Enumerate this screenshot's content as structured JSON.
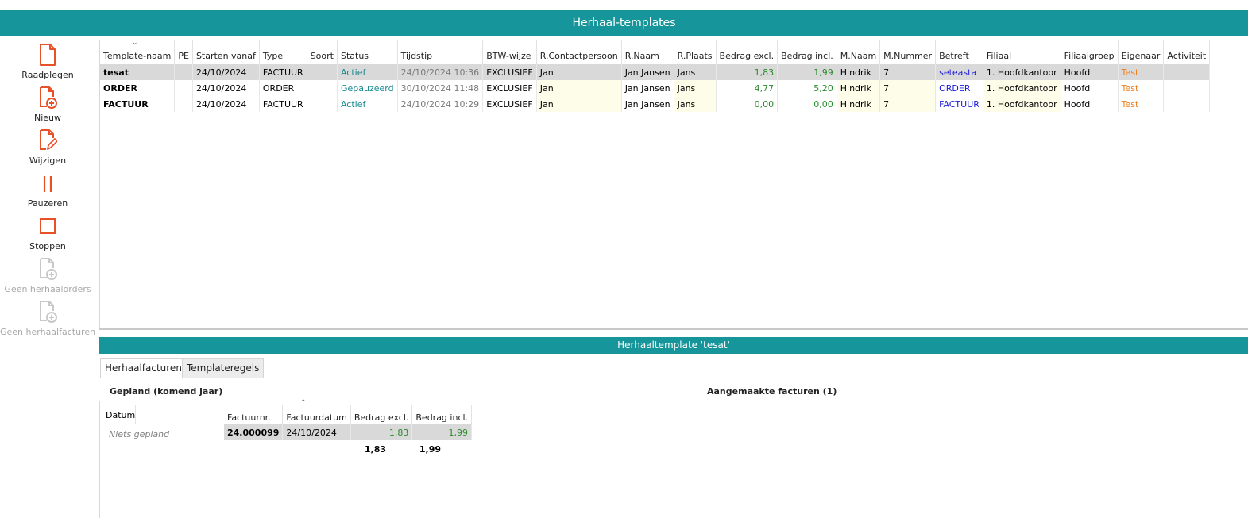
{
  "window": {
    "title": "Herhaal-templates"
  },
  "toolbar": {
    "raadplegen": "Raadplegen",
    "nieuw": "Nieuw",
    "wijzigen": "Wijzigen",
    "pauzeren": "Pauzeren",
    "stoppen": "Stoppen",
    "geen_orders": "Geen herhaalorders",
    "geen_facturen": "Geen herhaalfacturen"
  },
  "colors": {
    "accent": "#16969a",
    "icon": "#e8502a",
    "icon_disabled": "#c8c8c8"
  },
  "templates": {
    "columns": [
      "Template-naam",
      "PE",
      "Starten vanaf",
      "Type",
      "Soort",
      "Status",
      "Tijdstip",
      "BTW-wijze",
      "R.Contactpersoon",
      "R.Naam",
      "R.Plaats",
      "Bedrag excl.",
      "Bedrag incl.",
      "M.Naam",
      "M.Nummer",
      "Betreft",
      "Filiaal",
      "Filiaalgroep",
      "Eigenaar",
      "Activiteit"
    ],
    "rows": [
      [
        "tesat",
        "",
        "24/10/2024",
        "FACTUUR",
        "",
        "Actief",
        "24/10/2024 10:36",
        "EXCLUSIEF",
        "Jan",
        "Jan Jansen",
        "Jans",
        "1,83",
        "1,99",
        "Hindrik",
        "7",
        "seteasta",
        "1. Hoofdkantoor",
        "Hoofd",
        "Test",
        ""
      ],
      [
        "ORDER",
        "",
        "24/10/2024",
        "ORDER",
        "",
        "Gepauzeerd",
        "30/10/2024 11:48",
        "EXCLUSIEF",
        "Jan",
        "Jan Jansen",
        "Jans",
        "4,77",
        "5,20",
        "Hindrik",
        "7",
        "ORDER",
        "1. Hoofdkantoor",
        "Hoofd",
        "Test",
        ""
      ],
      [
        "FACTUUR",
        "",
        "24/10/2024",
        "FACTUUR",
        "",
        "Actief",
        "24/10/2024 10:29",
        "EXCLUSIEF",
        "Jan",
        "Jan Jansen",
        "Jans",
        "0,00",
        "0,00",
        "Hindrik",
        "7",
        "FACTUUR",
        "1. Hoofdkantoor",
        "Hoofd",
        "Test",
        ""
      ]
    ]
  },
  "detail": {
    "title": "Herhaaltemplate 'tesat'",
    "tabs": [
      "Herhaalfacturen",
      "Templateregels"
    ],
    "planned_title": "Gepland (komend jaar)",
    "planned_col": "Datum",
    "planned_empty": "Niets gepland",
    "made_title": "Aangemaakte facturen (1)",
    "made_columns": [
      "Factuurnr.",
      "Factuurdatum",
      "Bedrag excl.",
      "Bedrag incl."
    ],
    "made_rows": [
      [
        "24.000099",
        "24/10/2024",
        "1,83",
        "1,99"
      ]
    ],
    "total_excl": "1,83",
    "total_incl": "1,99"
  }
}
